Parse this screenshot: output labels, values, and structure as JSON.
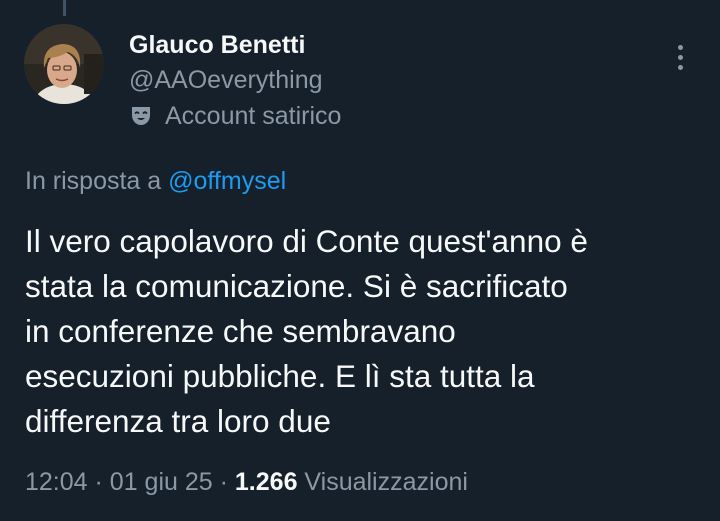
{
  "user": {
    "display_name": "Glauco Benetti",
    "handle": "@AAOeverything",
    "label": "Account satirico",
    "label_icon": "theater-mask-icon"
  },
  "more_icon": "more-vertical-icon",
  "reply": {
    "prefix": "In risposta a",
    "mention": "@offmysel"
  },
  "tweet": {
    "lines": [
      "Il vero capolavoro di Conte quest'anno è",
      "stata la comunicazione. Si è sacrificato",
      "in conferenze che sembravano",
      "esecuzioni pubbliche. E lì sta tutta la",
      "differenza tra loro due"
    ]
  },
  "meta": {
    "time": "12:04",
    "separator": "·",
    "date": "01 giu 25",
    "views_count": "1.266",
    "views_label": "Visualizzazioni"
  },
  "colors": {
    "background": "#15202b",
    "text_primary": "#f7f9f9",
    "text_secondary": "#8b98a5",
    "link": "#1d9bf0"
  }
}
